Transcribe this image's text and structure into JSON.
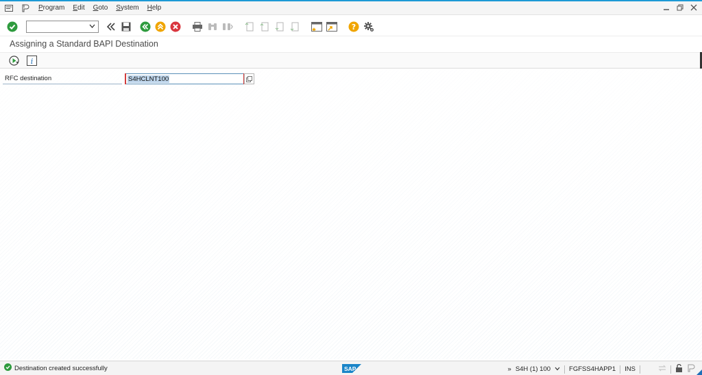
{
  "menu": {
    "items": [
      {
        "label": "Program",
        "u": "P",
        "rest": "rogram"
      },
      {
        "label": "Edit",
        "u": "E",
        "rest": "dit"
      },
      {
        "label": "Goto",
        "u": "G",
        "rest": "oto"
      },
      {
        "label": "System",
        "u": "S",
        "rest": "ystem"
      },
      {
        "label": "Help",
        "u": "H",
        "rest": "elp"
      }
    ]
  },
  "toolbar": {
    "command_field_value": ""
  },
  "screen": {
    "title": "Assigning a Standard BAPI Destination"
  },
  "form": {
    "rfc_label": "RFC destination",
    "rfc_value": "S4HCLNT100"
  },
  "status": {
    "message": "Destination created successfully",
    "system": "S4H (1) 100",
    "server": "FGFSS4HAPP1",
    "mode": "INS",
    "more": "»",
    "logo_text": "SAP"
  },
  "colors": {
    "accent": "#1d9ad6",
    "ok_green": "#2e9b3e",
    "cancel_red": "#d9363e",
    "nav_orange": "#f0a500"
  }
}
